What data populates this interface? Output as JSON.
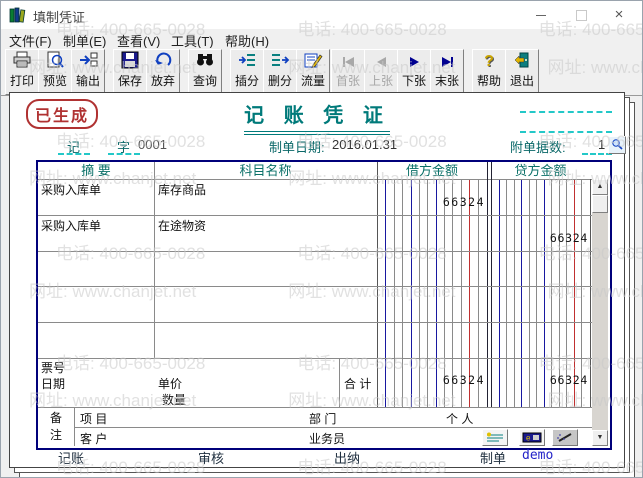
{
  "window": {
    "title": "填制凭证"
  },
  "menu": {
    "items": [
      "文件(F)",
      "制单(E)",
      "查看(V)",
      "工具(T)",
      "帮助(H)"
    ]
  },
  "toolbar": {
    "print": "打印",
    "preview": "预览",
    "export": "输出",
    "save": "保存",
    "abandon": "放弃",
    "query": "查询",
    "insert_line": "插分",
    "delete_line": "删分",
    "cashflow": "流量",
    "first": "首张",
    "prev": "上张",
    "next": "下张",
    "last": "末张",
    "help": "帮助",
    "exit": "退出"
  },
  "watermark": {
    "phone": "电话: 400-665-0028",
    "site": "网址: www.chanjet.net"
  },
  "voucher": {
    "stamp": "已生成",
    "title": "记 账 凭 证",
    "word_label": "记",
    "word_label2": "字",
    "number": "0001",
    "date_label": "制单日期:",
    "date": "2016.01.31",
    "attach_label": "附单据数:",
    "attach_count": "1",
    "table": {
      "headers": {
        "summary": "摘  要",
        "account": "科目名称",
        "debit": "借方金额",
        "credit": "贷方金额"
      },
      "rows": [
        {
          "summary": "采购入库单",
          "account": "库存商品",
          "debit": "66324",
          "credit": ""
        },
        {
          "summary": "采购入库单",
          "account": "在途物资",
          "debit": "",
          "credit": "66324"
        },
        {
          "summary": "",
          "account": "",
          "debit": "",
          "credit": ""
        },
        {
          "summary": "",
          "account": "",
          "debit": "",
          "credit": ""
        },
        {
          "summary": "",
          "account": "",
          "debit": "",
          "credit": ""
        }
      ],
      "footer": {
        "ticket_label": "票号",
        "date_label": "日期",
        "unit_price_label": "单价",
        "quantity_label": "数量",
        "total_label": "合 计",
        "total_debit": "66324",
        "total_credit": "66324"
      },
      "remark": {
        "label": "备注",
        "project": "项 目",
        "customer": "客 户",
        "department": "部 门",
        "salesman": "业务员",
        "person": "个 人"
      }
    },
    "signatures": {
      "bookkeeping_label": "记账",
      "audit_label": "审核",
      "cashier_label": "出纳",
      "preparer_label": "制单",
      "preparer": "demo"
    }
  }
}
